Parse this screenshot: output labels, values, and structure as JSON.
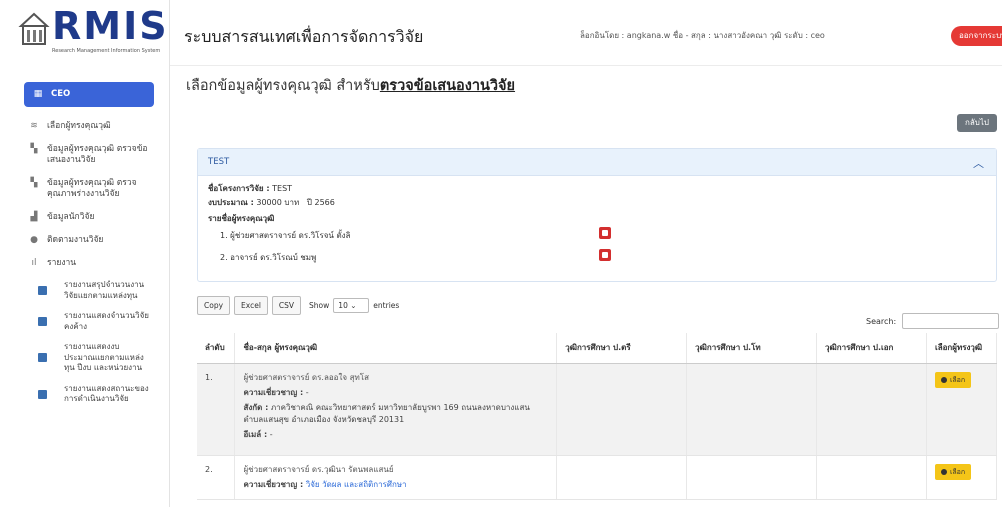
{
  "logo": {
    "text": "RMIS",
    "subtitle": "Research Management Information System"
  },
  "header": {
    "title": "ระบบสารสนเทศเพื่อการจัดการวิจัย",
    "meta": "ล็อกอินโดย : angkana.w    ชื่อ - สกุล : นางสาวอังคณา วุฒิ    ระดับ : ceo",
    "logout_label": "ออกจากระบบ"
  },
  "sidebar": {
    "items": [
      {
        "label": "CEO",
        "icon": "grid-icon"
      },
      {
        "label": "เลือกผู้ทรงคุณวุฒิ",
        "icon": "layers-icon"
      },
      {
        "label": "ข้อมูลผู้ทรงคุณวุฒิ ตรวจข้อเสนองานวิจัย",
        "icon": "panel-icon"
      },
      {
        "label": "ข้อมูลผู้ทรงคุณวุฒิ ตรวจคุณภาพร่างงานวิจัย",
        "icon": "panel-icon"
      },
      {
        "label": "ข้อมูลนักวิจัย",
        "icon": "users-icon"
      },
      {
        "label": "ติดตามงานวิจัย",
        "icon": "circle-icon"
      },
      {
        "label": "รายงาน",
        "icon": "bar-chart-icon"
      }
    ],
    "subitems": [
      {
        "label": "รายงานสรุปจำนวนงานวิจัยแยกตามแหล่งทุน"
      },
      {
        "label": "รายงานแสดงจำนวนวิจัยคงค้าง"
      },
      {
        "label": "รายงานแสดงงบประมาณแยกตามแหล่งทุน ปีงบ และหน่วยงาน"
      },
      {
        "label": "รายงานแสดงสถานะของการดำเนินงานวิจัย"
      }
    ]
  },
  "main": {
    "title_prefix": "เลือกข้อมูลผู้ทรงคุณวุฒิ สำหรับ",
    "title_emph": "ตรวจข้อเสนองานวิจัย",
    "back_label": "กลับไป",
    "card": {
      "header": "TEST",
      "project_label": "ชื่อโครงการวิจัย :",
      "project_value": "TEST",
      "budget_label": "งบประมาณ :",
      "budget_value": "30000 บาท",
      "year_value": "ปี 2566",
      "experts_label": "รายชื่อผู้ทรงคุณวุฒิ",
      "experts": [
        "1. ผู้ช่วยศาสตราจารย์ ดร.วิโรจน์ ตั้งลิ",
        "2. อาจารย์ ดร.วิโรณบ์ ชมพู"
      ]
    },
    "table_controls": {
      "copy": "Copy",
      "excel": "Excel",
      "csv": "CSV",
      "show": "Show",
      "entries_value": "10",
      "entries": "entries",
      "search": "Search:"
    },
    "table": {
      "headers": [
        "ลำดับ",
        "ชื่อ-สกุล ผู้ทรงคุณวุฒิ",
        "วุฒิการศึกษา ป.ตรี",
        "วุฒิการศึกษา ป.โท",
        "วุฒิการศึกษา ป.เอก",
        "เลือกผู้ทรงวุฒิ"
      ],
      "rows": [
        {
          "no": "1.",
          "name": "ผู้ช่วยศาสตราจารย์ ดร.ลออใจ สุทโส",
          "expertise_label": "ความเชี่ยวชาญ :",
          "expertise_value": "-",
          "affil_label": "สังกัด :",
          "affil_value": "ภาควิชาคณิ คณะวิทยาศาสตร์ มหาวิทยาลัยบูรพา 169 ถนนลงหาดบางแสน ตำบลแสนสุข อำเภอเมือง จังหวัดชลบุรี 20131",
          "email_label": "อีเมล์ :",
          "email_value": "-",
          "choose": "เลือก"
        },
        {
          "no": "2.",
          "name": "ผู้ช่วยศาสตราจารย์ ดร.วุฒินา รัตนพลแสนย์",
          "expertise_label": "ความเชี่ยวชาญ :",
          "expertise_value": "วิจัย วัดผล และสถิติการศึกษา",
          "choose": "เลือก"
        }
      ]
    }
  }
}
